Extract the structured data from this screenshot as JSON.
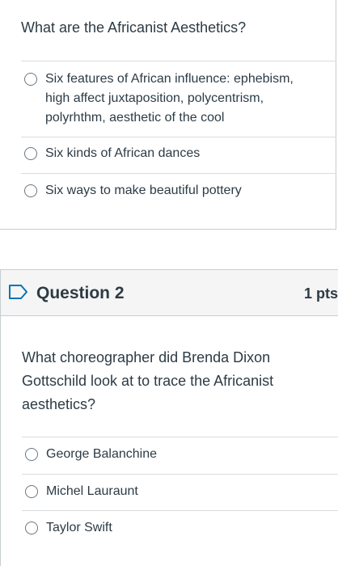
{
  "question1": {
    "text": "What are the Africanist Aesthetics?",
    "answers": [
      {
        "label": "Six features of African influence: ephebism, high affect juxtaposition, polycentrism, polyrhthm, aesthetic of the cool"
      },
      {
        "label": "Six kinds of African dances"
      },
      {
        "label": "Six ways to make beautiful pottery"
      }
    ]
  },
  "question2": {
    "title": "Question 2",
    "points": "1 pts",
    "text": "What choreographer did Brenda Dixon Gottschild look at to trace the Africanist aesthetics?",
    "answers": [
      {
        "label": "George Balanchine"
      },
      {
        "label": "Michel Lauraunt"
      },
      {
        "label": "Taylor Swift"
      }
    ]
  }
}
